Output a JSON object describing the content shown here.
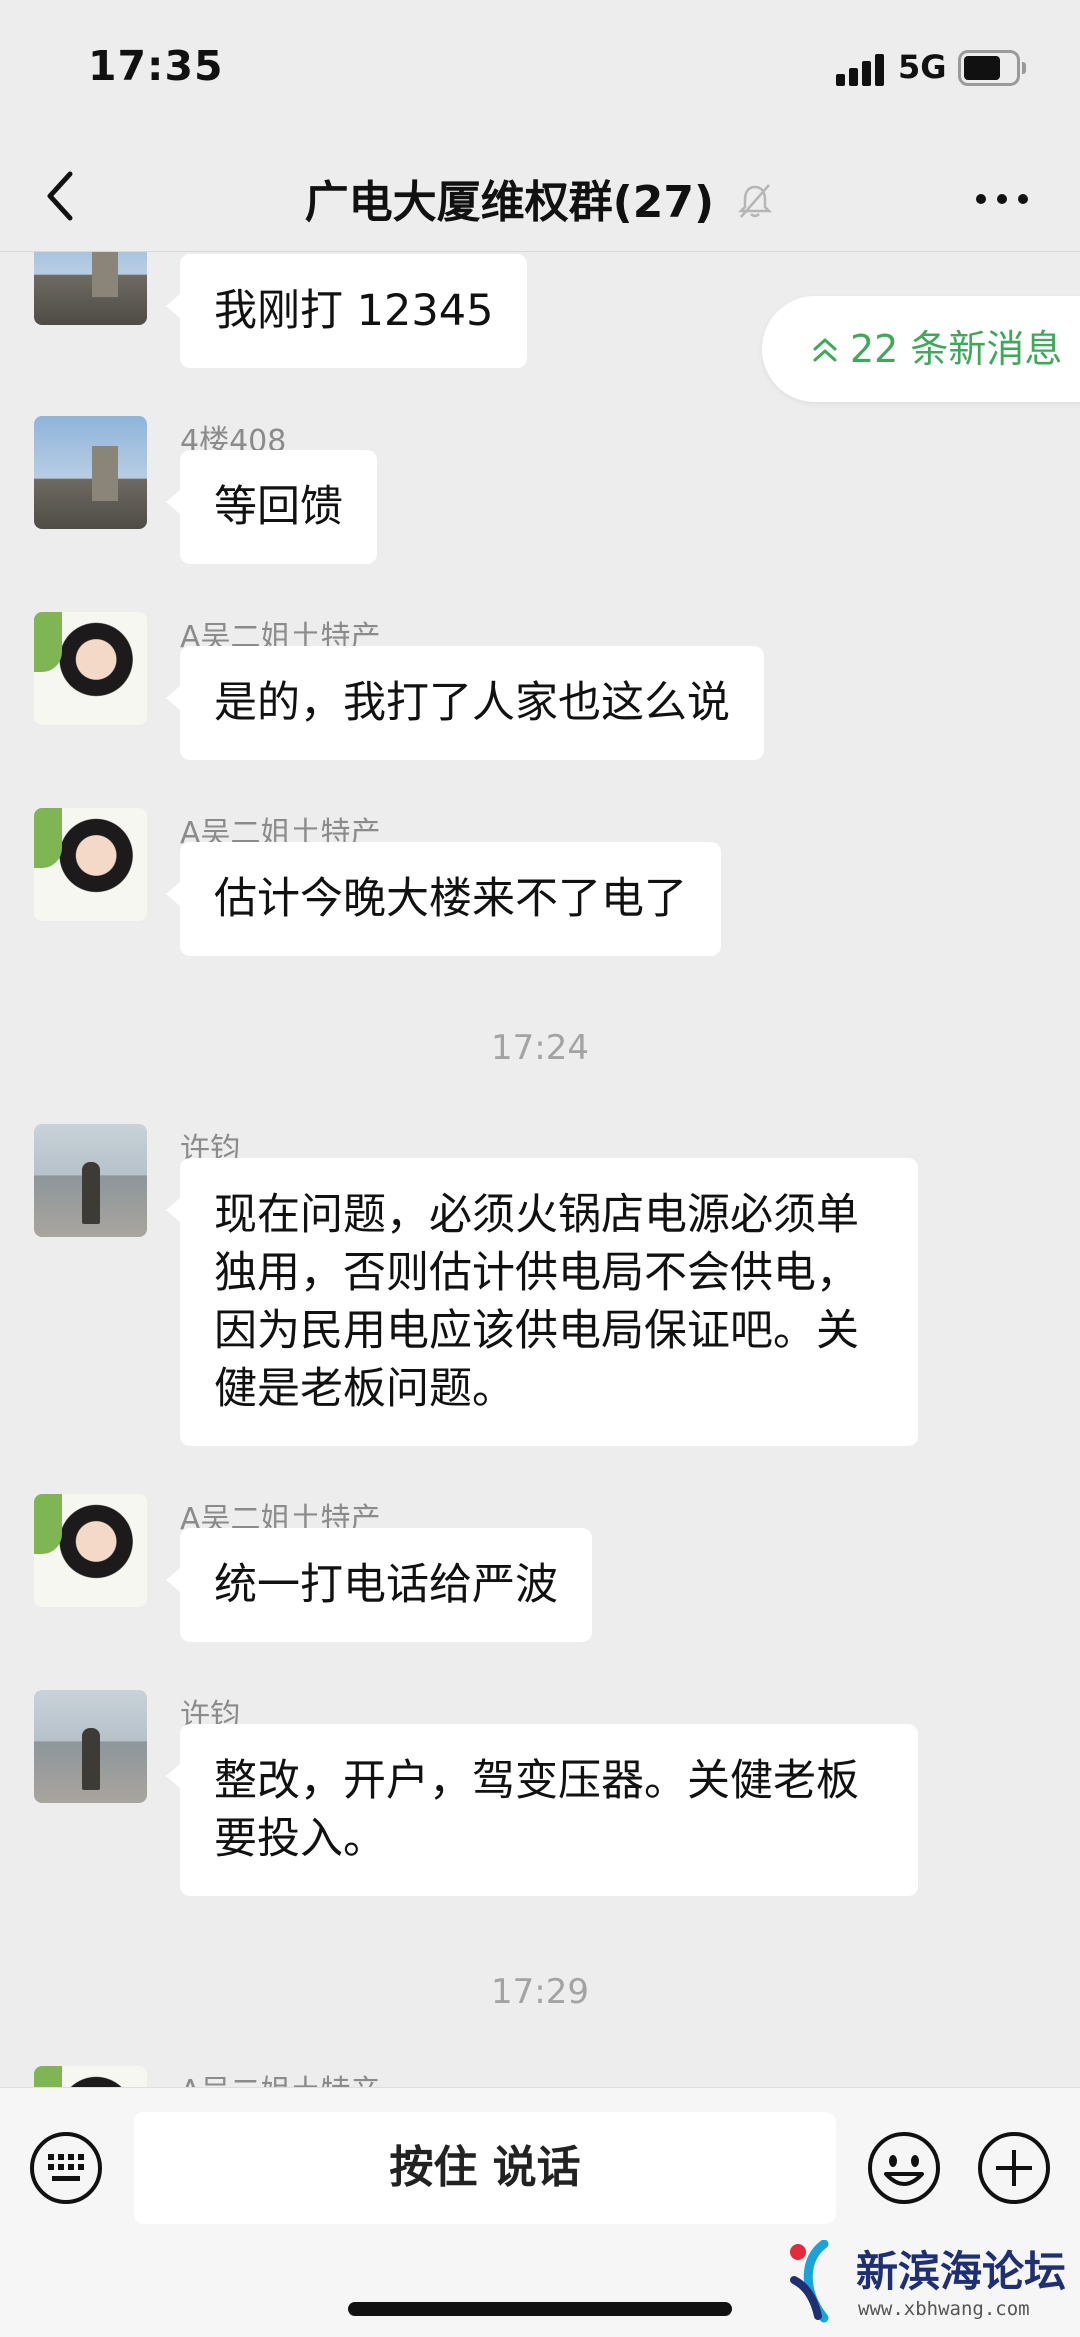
{
  "status_bar": {
    "time": "17:35",
    "network": "5G"
  },
  "nav": {
    "title": "广电大厦维权群(27)"
  },
  "new_messages": {
    "label": "22 条新消息"
  },
  "messages": [
    {
      "sender": "",
      "text": "我刚打 12345"
    },
    {
      "sender": "4楼408",
      "text": "等回馈"
    },
    {
      "sender": "A吴二姐土特产",
      "text": "是的，我打了人家也这么说"
    },
    {
      "sender": "A吴二姐土特产",
      "text": "估计今晚大楼来不了电了"
    },
    {
      "sender": "许钧",
      "text": "现在问题，必须火锅店电源必须单独用，否则估计供电局不会供电，因为民用电应该供电局保证吧。关健是老板问题。"
    },
    {
      "sender": "A吴二姐土特产",
      "text": "统一打电话给严波"
    },
    {
      "sender": "许钧",
      "text": "整改，开户，驾变压器。关健老板要投入。"
    },
    {
      "sender": "A吴二姐土特产",
      "text": ""
    }
  ],
  "time_separators": [
    "17:24",
    "17:29"
  ],
  "input_bar": {
    "voice_label": "按住 说话"
  },
  "watermark": {
    "title": "新滨海论坛",
    "url": "www.xbhwang.com"
  },
  "colors": {
    "accent_green": "#3fa85a",
    "background": "#ededed",
    "bubble": "#ffffff"
  }
}
